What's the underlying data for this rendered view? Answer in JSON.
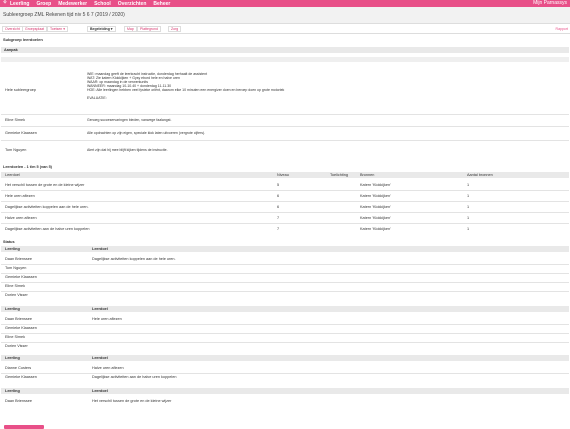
{
  "topbar": {
    "logo_icon": "rocket-icon",
    "nav": [
      "Leerling",
      "Groep",
      "Medewerker",
      "School",
      "Overzichten",
      "Beheer"
    ],
    "user": "Mijn Parnassys"
  },
  "subbar": {
    "title": "Subleergroep ZML Rekenen tijd niv 5 6 7 (2019 / 2020)"
  },
  "tabs": [
    "Overzicht",
    "Groepsplaat",
    "Toetsen ▾",
    "Begeleiding ▾",
    "Map",
    "Plattegrond",
    "Zorg"
  ],
  "active_tab": "Begeleiding ▾",
  "rapportage": "Rapport",
  "page_title": "Subgroep leerdoelen",
  "aanpak": {
    "header": "Aanpak",
    "rows": [
      {
        "label": "Hele subleergroep",
        "lines": [
          "WIE: maandag geeft de leerkracht instructie, donderdag herhaalt de assistent",
          "WAT: Zie katern Klokkijken + Gysy ebord hele en halve uren",
          "WAAR: op maandag in de verwerkunits",
          "WANNEER: maandag 10-10.40 + donderdag 11-11.30",
          "HOE: Alle leerlingen hebben veel fysieke oriënt, daarom elke 10 minuten een energizer doen en beroep doen op grote motoriek",
          "",
          "EVALUATIE:"
        ]
      },
      {
        "label": "Eline Simek",
        "lines": [
          "Genoeg succeservaringen bieden, vanwege faalangst."
        ]
      },
      {
        "label": "Gemieke Klaassen",
        "lines": [
          "Alle opdrachten op zijn eigen, speciale klok laten uitvoeren (vergrote cijfers)."
        ]
      },
      {
        "label": "Tom Nguyen",
        "lines": [
          "Alert zijn dat hij mee blijft kijken tijdens de instructie."
        ]
      }
    ]
  },
  "leerdoelen": {
    "header": "Leerdoelen - 1 t/m 5 (van 5)",
    "columns": [
      "Leerdoel",
      "Niveau",
      "Toelichting",
      "Bronnen",
      "Aantal bronnen"
    ],
    "rows": [
      [
        "Het verschil tussen de grote en de kleine wijzer",
        "5",
        "",
        "Katern 'Klokkijken'",
        "1"
      ],
      [
        "Hele uren aflezen",
        "6",
        "",
        "Katern 'Klokkijken'",
        "1"
      ],
      [
        "Dagelijkse activiteiten koppelen aan de hele uren.",
        "6",
        "",
        "Katern 'Klokkijken'",
        "1"
      ],
      [
        "Halve uren aflezen",
        "7",
        "",
        "Katern 'Klokkijken'",
        "1"
      ],
      [
        "Dagelijkse activiteiten aan de halve uren koppelen",
        "7",
        "",
        "Katern 'Klokkijken'",
        "1"
      ]
    ]
  },
  "status": {
    "header": "Status",
    "columns": [
      "Leerling",
      "Leerdoel"
    ],
    "groups": [
      {
        "rows": [
          [
            "Daan Brienssee",
            "Dagelijkse activiteiten koppelen aan de hele uren."
          ],
          [
            "Tom Nguyen",
            ""
          ],
          [
            "Gemieke Klaassen",
            ""
          ],
          [
            "Eline Simek",
            ""
          ],
          [
            "Dorien Visser",
            ""
          ]
        ]
      },
      {
        "rows": [
          [
            "Daan Brienssee",
            "Hele uren aflezen"
          ],
          [
            "Gemieke Klaassen",
            ""
          ],
          [
            "Eline Simek",
            ""
          ],
          [
            "Dorien Visser",
            ""
          ]
        ]
      },
      {
        "rows": [
          [
            "Dianne Custers",
            "Halve uren aflezen"
          ],
          [
            "Gemieke Klaassen",
            "Dagelijkse activiteiten aan de halve uren koppelen"
          ]
        ]
      },
      {
        "rows": [
          [
            "Daan Brienssee",
            "Het verschil tussen de grote en de kleine wijzer"
          ]
        ]
      }
    ]
  },
  "colors": {
    "accent": "#e84f88",
    "band": "#e9e9e9"
  }
}
